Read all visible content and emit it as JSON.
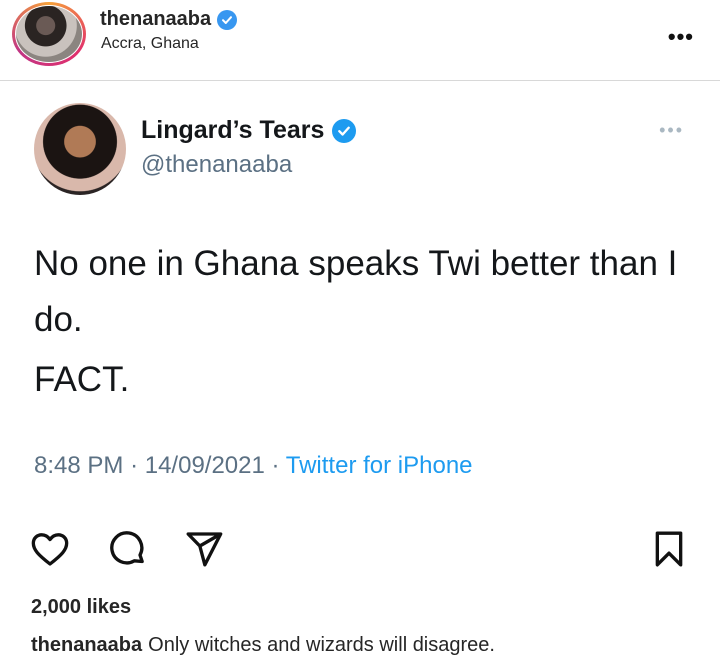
{
  "post_header": {
    "username": "thenanaaba",
    "location": "Accra, Ghana",
    "more_icon": "more-dots-icon"
  },
  "tweet": {
    "display_name": "Lingard’s Tears",
    "handle": "@thenanaaba",
    "body": "No one in Ghana speaks Twi better than I do.",
    "body_line2": "FACT.",
    "time": "8:48 PM",
    "separator": "·",
    "date": "14/09/2021",
    "source": "Twitter for iPhone"
  },
  "actions": {
    "like_icon": "heart-icon",
    "comment_icon": "comment-icon",
    "share_icon": "send-icon",
    "save_icon": "bookmark-icon"
  },
  "likes": "2,000 likes",
  "caption": {
    "username": "thenanaaba",
    "text": "Only witches and wizards will disagree."
  },
  "colors": {
    "verified_blue": "#3897f0",
    "twitter_blue": "#1d9bf0",
    "muted_text": "#5b7083"
  }
}
